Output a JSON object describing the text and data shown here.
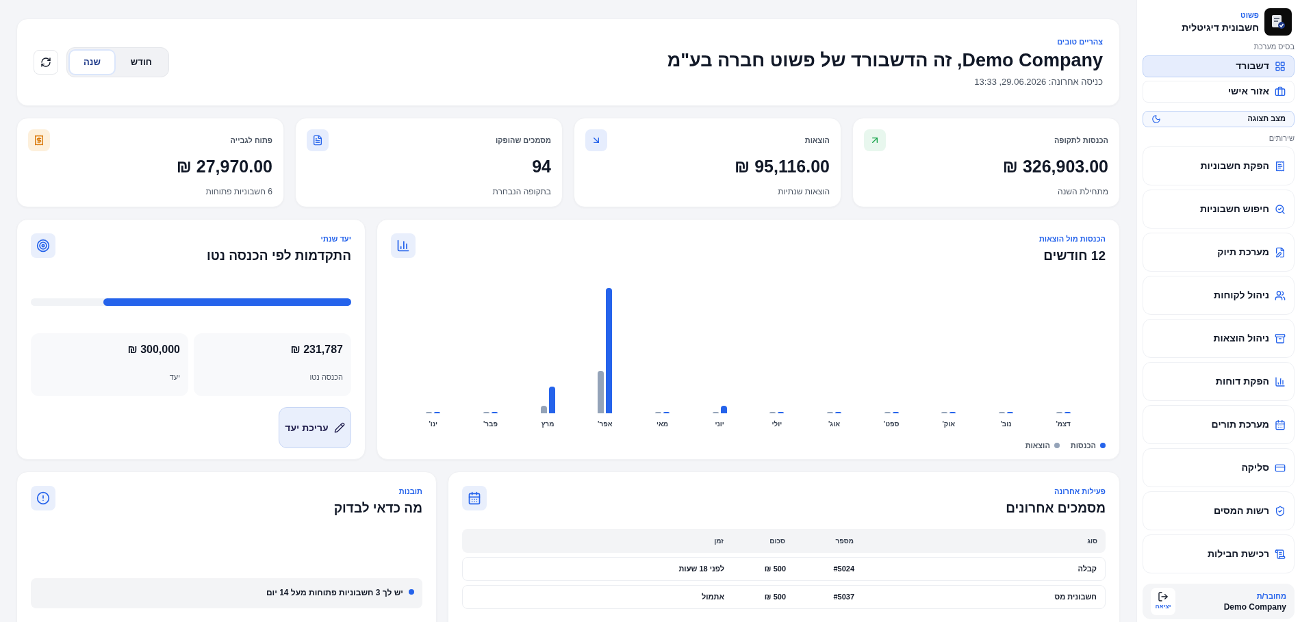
{
  "sidebar": {
    "brand_caption": "פשוט",
    "brand_title": "חשבונית דיגיטלית",
    "section_system": "בסיס מערכת",
    "main_items": [
      {
        "kind": "dashboard",
        "label": "דשבורד",
        "selected": true
      },
      {
        "kind": "personal",
        "label": "אזור אישי",
        "selected": false
      }
    ],
    "theme_toggle": {
      "label": "מצב תצוגה"
    },
    "section_services": "שירותים",
    "service_items": [
      {
        "kind": "invoice",
        "label": "הפקת חשבוניות"
      },
      {
        "kind": "search",
        "label": "חיפוש חשבוניות"
      },
      {
        "kind": "filing",
        "label": "מערכת תיוק"
      },
      {
        "kind": "customers",
        "label": "ניהול לקוחות"
      },
      {
        "kind": "expenses",
        "label": "ניהול הוצאות"
      },
      {
        "kind": "reports",
        "label": "הפקת דוחות"
      },
      {
        "kind": "appointments",
        "label": "מערכת תורים"
      },
      {
        "kind": "clearing",
        "label": "סליקה"
      },
      {
        "kind": "tax",
        "label": "רשות המסים"
      },
      {
        "kind": "packages",
        "label": "רכישת חבילות"
      }
    ],
    "user": {
      "caption": "מחובר/ת",
      "name": "Demo Company",
      "logout": "יציאה"
    }
  },
  "header": {
    "greeting": "צהריים טובים",
    "title": "Demo Company, זה הדשבורד של פשוט חברה בע\"מ",
    "last_login": "כניסה אחרונה: 29.06.2026, 13:33",
    "period_tabs": [
      {
        "label": "חודש",
        "selected": false
      },
      {
        "label": "שנה",
        "selected": true
      }
    ]
  },
  "stats": [
    {
      "kind": "income",
      "label": "הכנסות לתקופה",
      "value": "326,903.00 ₪",
      "caption": "מתחילת השנה"
    },
    {
      "kind": "expenses",
      "label": "הוצאות",
      "value": "95,116.00 ₪",
      "caption": "הוצאות שנתיות"
    },
    {
      "kind": "documents",
      "label": "מסמכים שהופקו",
      "value": "94",
      "caption": "בתקופה הנבחרת"
    },
    {
      "kind": "open",
      "label": "פתוח לגבייה",
      "value": "27,970.00 ₪",
      "caption": "6 חשבוניות פתוחות"
    }
  ],
  "chart_card": {
    "eyebrow": "הכנסות מול הוצאות",
    "title": "12 חודשים",
    "months": [
      "דצמ'",
      "נוב'",
      "אוק'",
      "ספט'",
      "אוג'",
      "יולי",
      "יוני",
      "מאי",
      "אפר'",
      "מרץ",
      "פבר'",
      "ינו'"
    ],
    "legend": [
      {
        "label": "הכנסות",
        "color": "#2563eb"
      },
      {
        "label": "הוצאות",
        "color": "#94a3b8"
      }
    ]
  },
  "goal_card": {
    "eyebrow": "יעד שנתי",
    "title": "התקדמות לפי הכנסה נטו",
    "level": 0.773,
    "boxes": [
      {
        "value": "231,787 ₪",
        "label": "הכנסה נטו"
      },
      {
        "value": "300,000 ₪",
        "label": "יעד"
      }
    ],
    "edit_button": "עריכת יעד"
  },
  "documents_card": {
    "eyebrow": "פעילות אחרונה",
    "title": "מסמכים אחרונים",
    "columns": [
      "סוג",
      "מספר",
      "סכום",
      "זמן"
    ],
    "rows": [
      [
        "קבלה",
        "#5024",
        "500 ₪",
        "לפני 18 שעות"
      ],
      [
        "חשבונית מס",
        "#5037",
        "500 ₪",
        "אתמול"
      ]
    ]
  },
  "insights_card": {
    "eyebrow": "תובנות",
    "title": "מה כדאי לבדוק",
    "items": [
      "יש לך 3 חשבוניות פתוחות מעל 14 יום"
    ]
  }
}
